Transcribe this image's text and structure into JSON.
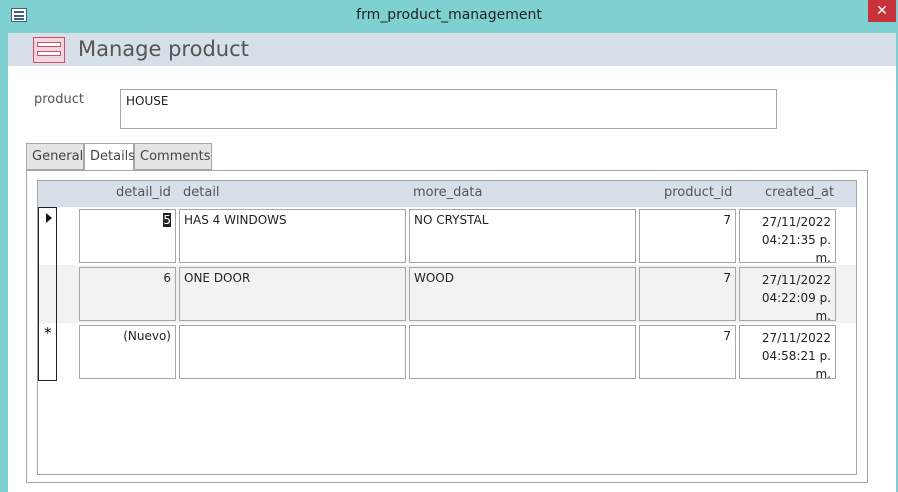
{
  "window": {
    "title": "frm_product_management",
    "close_glyph": "✕",
    "icon": "form-window-icon"
  },
  "header": {
    "title": "Manage product",
    "icon": "form-icon"
  },
  "product": {
    "label": "product",
    "value": "HOUSE"
  },
  "tabs": [
    {
      "label": "General"
    },
    {
      "label": "Details"
    },
    {
      "label": "Comments"
    }
  ],
  "active_tab": "Details",
  "grid": {
    "columns": [
      "detail_id",
      "detail",
      "more_data",
      "product_id",
      "created_at"
    ],
    "rows": [
      {
        "detail_id": "5",
        "detail": "HAS 4 WINDOWS",
        "more_data": "NO CRYSTAL",
        "product_id": "7",
        "date": "27/11/2022",
        "time": "04:21:35 p. m."
      },
      {
        "detail_id": "6",
        "detail": "ONE DOOR",
        "more_data": "WOOD",
        "product_id": "7",
        "date": "27/11/2022",
        "time": "04:22:09 p. m."
      },
      {
        "detail_id": "(Nuevo)",
        "detail": "",
        "more_data": "",
        "product_id": "7",
        "date": "27/11/2022",
        "time": "04:58:21 p. m."
      }
    ],
    "new_row_glyph": "*"
  },
  "colors": {
    "title_bar": "#7fd1d1",
    "header_band": "#d7dfe9",
    "close_button": "#c8323a"
  }
}
